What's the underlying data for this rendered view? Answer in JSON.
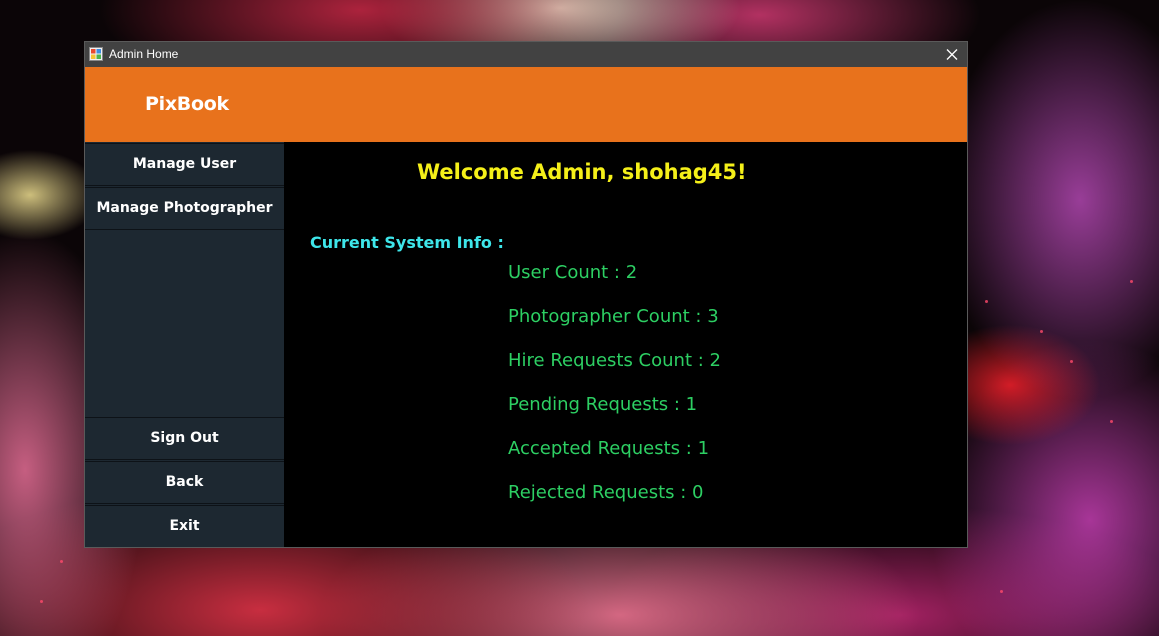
{
  "window": {
    "title": "Admin Home",
    "icons": {
      "app": "app-icon",
      "close": "close-icon"
    }
  },
  "header": {
    "brand": "PixBook"
  },
  "sidebar": {
    "items": [
      {
        "label": "Manage User"
      },
      {
        "label": "Manage Photographer"
      },
      {
        "label": "Sign Out"
      },
      {
        "label": "Back"
      },
      {
        "label": "Exit"
      }
    ]
  },
  "main": {
    "welcome": "Welcome Admin, shohag45!",
    "info_heading": "Current System Info :",
    "stats": [
      {
        "label": "User Count : 2"
      },
      {
        "label": "Photographer Count : 3"
      },
      {
        "label": "Hire Requests Count : 2"
      },
      {
        "label": "Pending Requests : 1"
      },
      {
        "label": "Accepted Requests : 1"
      },
      {
        "label": "Rejected Requests : 0"
      }
    ]
  },
  "colors": {
    "header_bg": "#e8721c",
    "sidebar_bg": "#1d2831",
    "content_bg": "#000000",
    "welcome_text": "#f5f019",
    "info_heading_text": "#3ee6ea",
    "stat_text": "#2dcf63",
    "titlebar_bg": "#424242"
  }
}
